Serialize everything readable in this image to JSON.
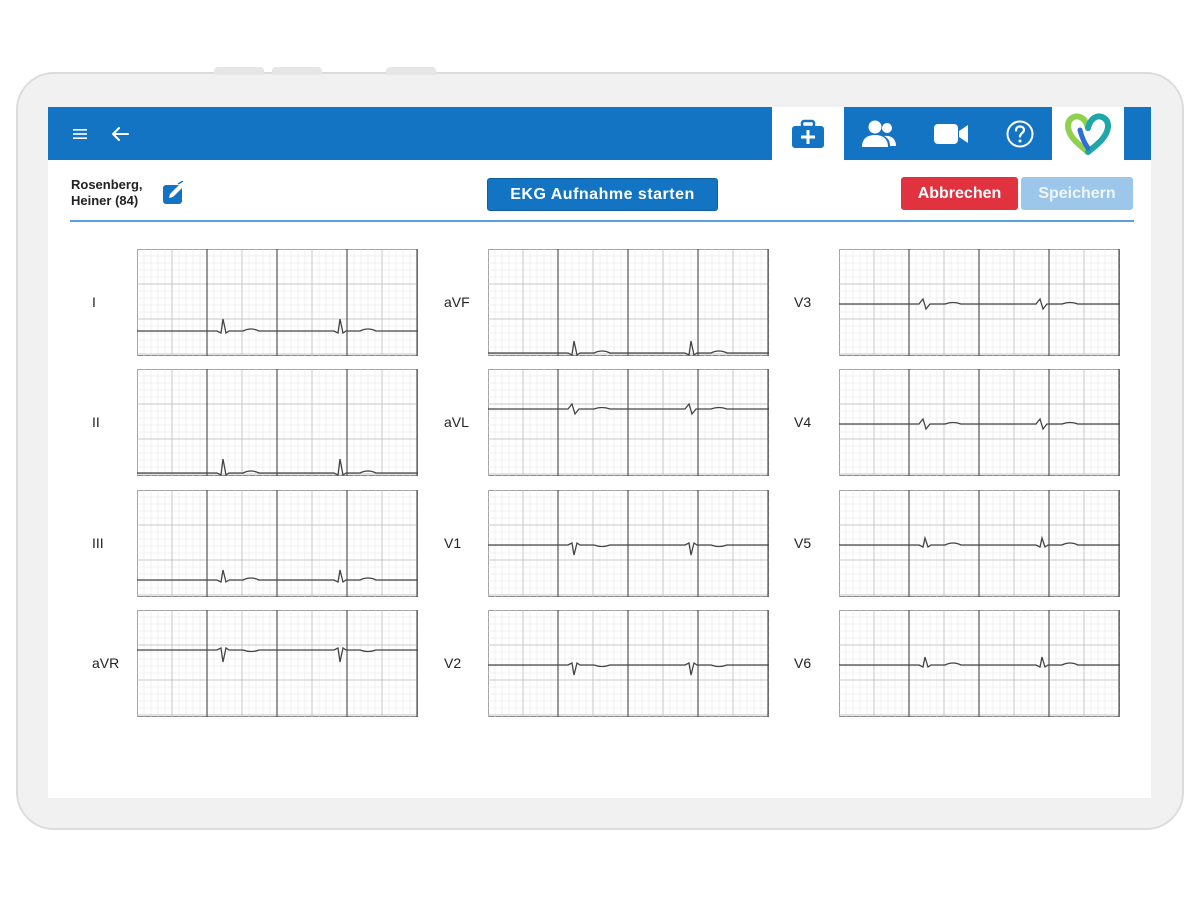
{
  "app": {
    "nav": {
      "menu_icon": "menu-icon",
      "back_icon": "arrow-left-icon",
      "tabs": [
        {
          "name": "medical-kit",
          "icon": "medical-kit-icon",
          "active": true
        },
        {
          "name": "patients",
          "icon": "users-icon",
          "active": false
        },
        {
          "name": "video",
          "icon": "video-camera-icon",
          "active": false
        },
        {
          "name": "help",
          "icon": "question-circle-icon",
          "active": false
        }
      ],
      "logo_icon": "heart-logo-icon"
    },
    "colors": {
      "primary": "#1474c4",
      "danger": "#e1323f",
      "disabled": "#9cc7ea",
      "logo_green": "#8fd14f",
      "logo_teal": "#1ea6a8",
      "logo_blue": "#2d6fd6"
    }
  },
  "patient": {
    "name_line1": "Rosenberg,",
    "name_line2": "Heiner (84)",
    "edit_icon": "edit-icon"
  },
  "actions": {
    "start": "EKG Aufnahme starten",
    "cancel": "Abbrechen",
    "save": "Speichern"
  },
  "ecg": {
    "leads": [
      {
        "label": "I",
        "polarity": "positive"
      },
      {
        "label": "II",
        "polarity": "positive"
      },
      {
        "label": "III",
        "polarity": "positive"
      },
      {
        "label": "aVR",
        "polarity": "negative"
      },
      {
        "label": "aVF",
        "polarity": "positive"
      },
      {
        "label": "aVL",
        "polarity": "biphasic"
      },
      {
        "label": "V1",
        "polarity": "negative"
      },
      {
        "label": "V2",
        "polarity": "negative"
      },
      {
        "label": "V3",
        "polarity": "biphasic"
      },
      {
        "label": "V4",
        "polarity": "biphasic"
      },
      {
        "label": "V5",
        "polarity": "positive"
      },
      {
        "label": "V6",
        "polarity": "positive"
      }
    ]
  }
}
